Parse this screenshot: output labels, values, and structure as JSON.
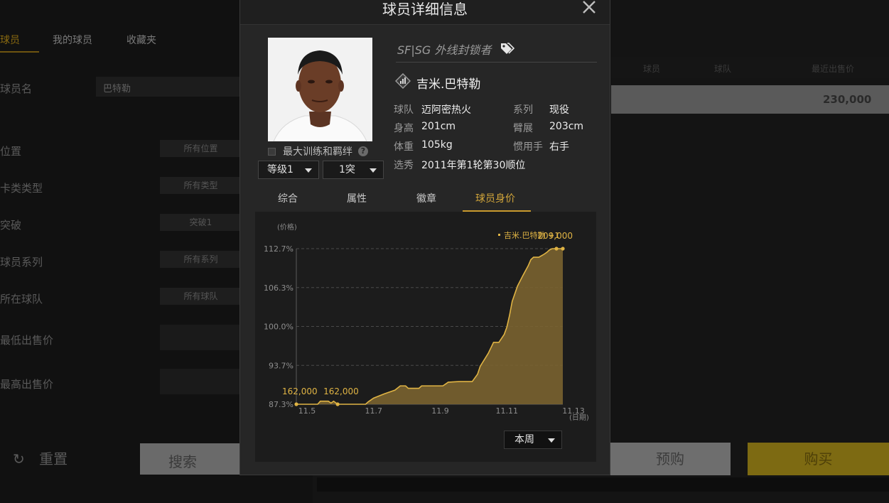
{
  "background": {
    "tabs": [
      {
        "label": "球员",
        "active": true
      },
      {
        "label": "我的球员",
        "active": false
      },
      {
        "label": "收藏夹",
        "active": false
      }
    ],
    "filters": [
      {
        "label": "球员名",
        "value": "巴特勒"
      },
      {
        "label": "位置",
        "value": "所有位置"
      },
      {
        "label": "卡类类型",
        "value": "所有类型"
      },
      {
        "label": "突破",
        "value": "突破1"
      },
      {
        "label": "球员系列",
        "value": "所有系列"
      },
      {
        "label": "所在球队",
        "value": "所有球队"
      },
      {
        "label": "最低出售价",
        "value": ""
      },
      {
        "label": "最高出售价",
        "value": ""
      }
    ],
    "reset_label": "重置",
    "search_label": "搜索",
    "table_headers": [
      "球员",
      "球队",
      "最近出售价"
    ],
    "row_price": "230,000",
    "preorder_label": "预购",
    "buy_label": "购买"
  },
  "modal": {
    "title": "球员详细信息",
    "position_tag": "SF|SG 外线封锁者",
    "player_name": "吉米.巴特勒",
    "checkbox_label": "最大训练和羁绊",
    "level_select": "等级1",
    "break_select": "1突",
    "info": [
      {
        "label": "球队",
        "value": "迈阿密热火"
      },
      {
        "label": "系列",
        "value": "现役"
      },
      {
        "label": "身高",
        "value": "201cm"
      },
      {
        "label": "臂展",
        "value": "203cm"
      },
      {
        "label": "体重",
        "value": "105kg"
      },
      {
        "label": "惯用手",
        "value": "右手"
      },
      {
        "label": "选秀",
        "value": "2011年第1轮第30顺位"
      }
    ],
    "tabs": [
      {
        "label": "综合",
        "active": false
      },
      {
        "label": "属性",
        "active": false
      },
      {
        "label": "徽章",
        "active": false
      },
      {
        "label": "球员身价",
        "active": true
      }
    ],
    "period_select": "本周"
  },
  "colors": {
    "accent": "#d4a73a",
    "fill": "#7a6330",
    "line": "#e0b444",
    "panel": "#1c1c1c"
  },
  "chart_data": {
    "type": "area",
    "ylabel": "(价格)",
    "xlabel": "(日期)",
    "legend": "吉米.巴特勒 +1",
    "legend_position": "top-right",
    "y_ticks": [
      "87.3%",
      "93.7%",
      "100.0%",
      "106.3%",
      "112.7%"
    ],
    "ylim": [
      87.3,
      112.7
    ],
    "x_ticks": [
      "11.5",
      "11.7",
      "11.9",
      "11.11",
      "11.13"
    ],
    "xlim": [
      0,
      100
    ],
    "grid": true,
    "annotations": [
      {
        "label": "162,000",
        "x": 0,
        "y": 87.3
      },
      {
        "label": "162,000",
        "x": 15.5,
        "y": 87.3
      },
      {
        "label": "209,000",
        "x": 100,
        "y": 112.7
      }
    ],
    "series": [
      {
        "name": "吉米.巴特勒 +1",
        "x": [
          0,
          8,
          9,
          12,
          13,
          14,
          15.5,
          17,
          26,
          27,
          29,
          33,
          37,
          39,
          41,
          42,
          46,
          47,
          55,
          56,
          57,
          61,
          63,
          66,
          68,
          69,
          70,
          72,
          74,
          76,
          78,
          79,
          80,
          81,
          83,
          85,
          87,
          88,
          89,
          90,
          91,
          93,
          94,
          95,
          96,
          97,
          100
        ],
        "y": [
          87.3,
          87.3,
          87.8,
          87.8,
          87.5,
          87.8,
          87.3,
          87.3,
          87.3,
          87.7,
          88.3,
          89.0,
          89.6,
          90.3,
          90.3,
          89.9,
          89.9,
          90.3,
          90.3,
          90.6,
          90.9,
          91.0,
          91.0,
          91.0,
          92.2,
          93.5,
          94.2,
          95.6,
          97.4,
          97.4,
          98.7,
          99.9,
          101.8,
          104.1,
          106.6,
          108.3,
          109.9,
          110.9,
          111.3,
          111.3,
          111.3,
          111.8,
          112.1,
          112.5,
          112.7,
          112.7,
          112.7
        ]
      }
    ]
  }
}
